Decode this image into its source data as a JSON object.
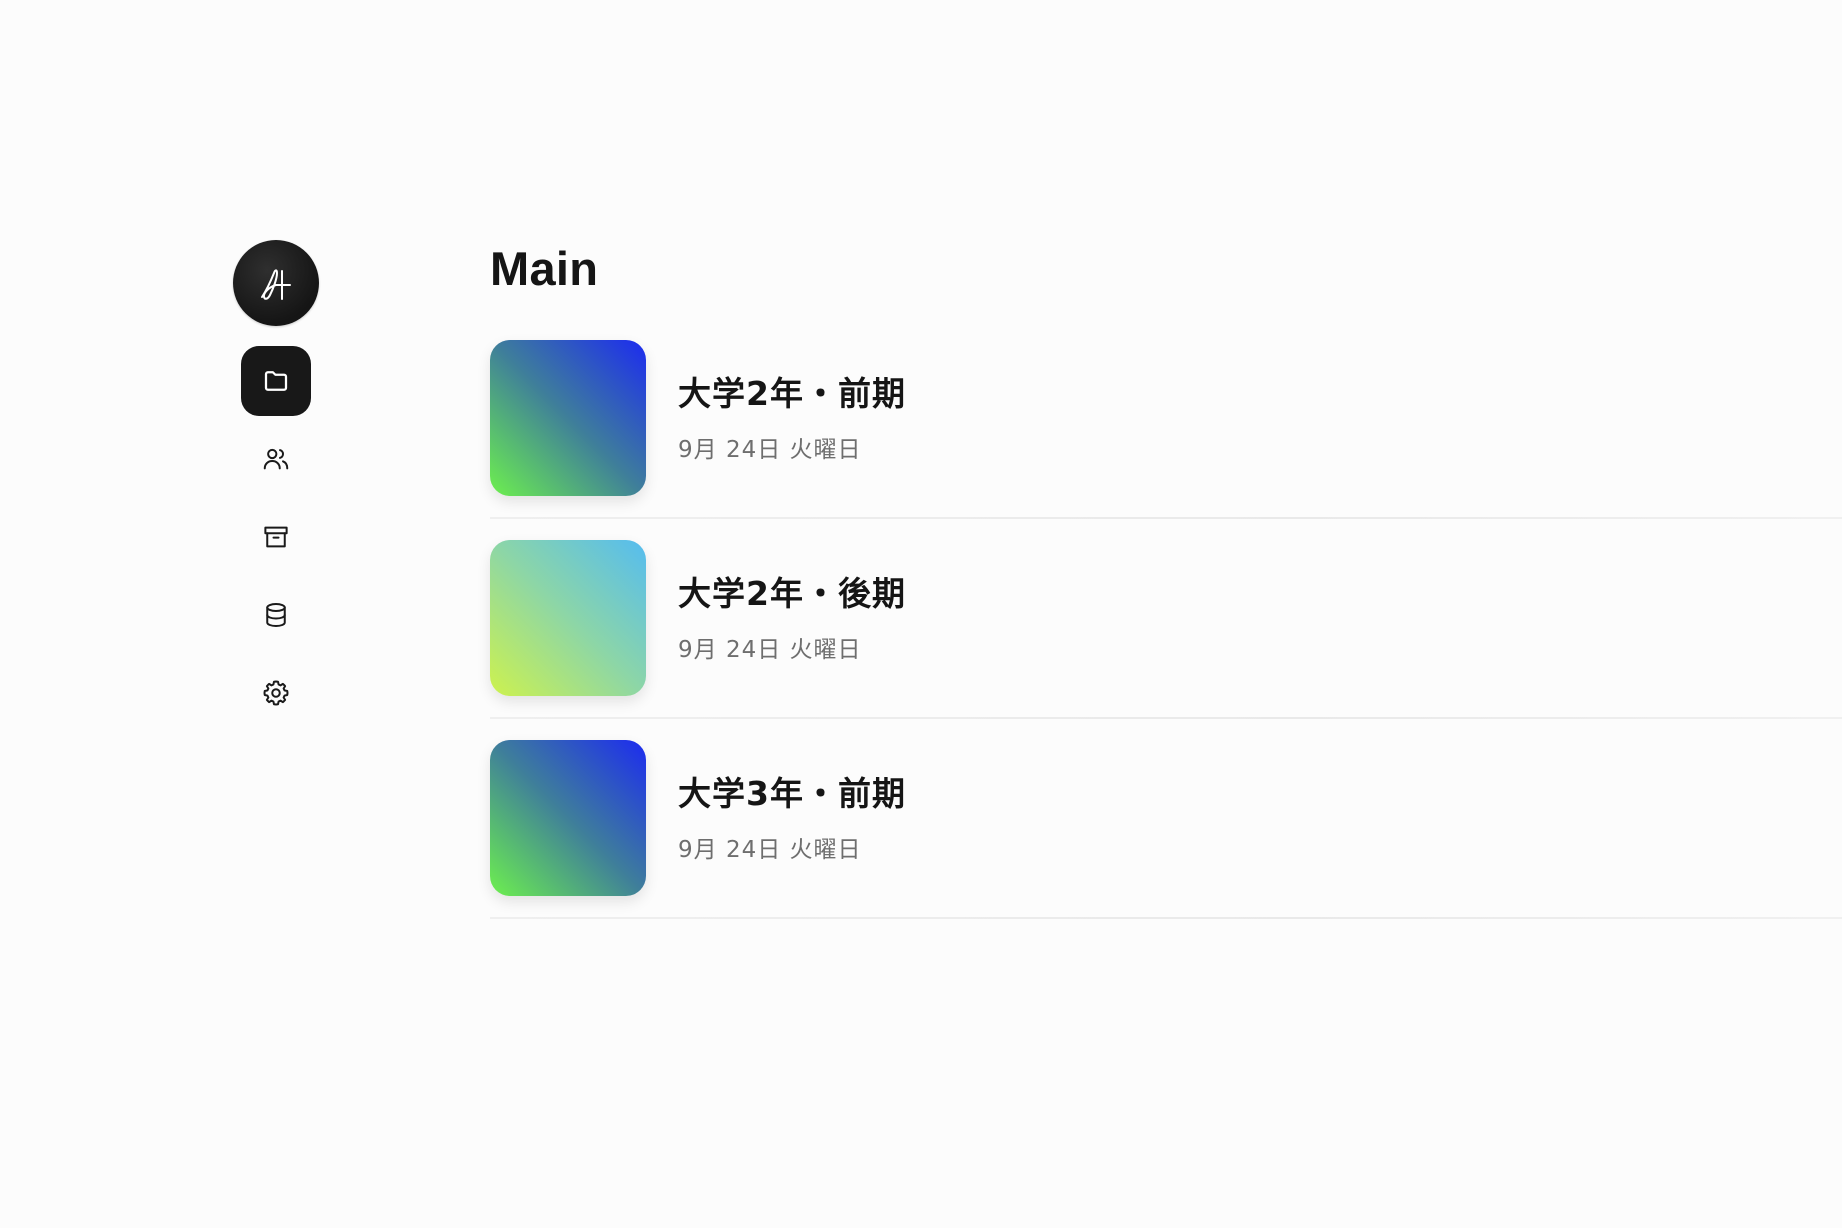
{
  "app": {
    "logo_icon": "signature-logo-icon"
  },
  "sidebar": {
    "items": [
      {
        "icon": "folder-icon",
        "label": "files",
        "active": true
      },
      {
        "icon": "users-icon",
        "label": "people",
        "active": false
      },
      {
        "icon": "archive-icon",
        "label": "archive",
        "active": false
      },
      {
        "icon": "database-icon",
        "label": "database",
        "active": false
      },
      {
        "icon": "gear-icon",
        "label": "settings",
        "active": false
      }
    ]
  },
  "main": {
    "title": "Main",
    "items": [
      {
        "title": "大学2年・前期",
        "date": "9月 24日 火曜日",
        "gradient": [
          "#1c2bf0",
          "#3f7f9a",
          "#6df04e"
        ]
      },
      {
        "title": "大学2年・後期",
        "date": "9月 24日 火曜日",
        "gradient": [
          "#55bcf0",
          "#8dd6a6",
          "#cdf24e"
        ]
      },
      {
        "title": "大学3年・前期",
        "date": "9月 24日 火曜日",
        "gradient": [
          "#1c2bf0",
          "#3f7f9a",
          "#6df04e"
        ]
      }
    ]
  },
  "colors": {
    "background": "#fcfcfc",
    "active_nav": "#181818",
    "text_primary": "#151515",
    "text_secondary": "#6e6e6e"
  }
}
